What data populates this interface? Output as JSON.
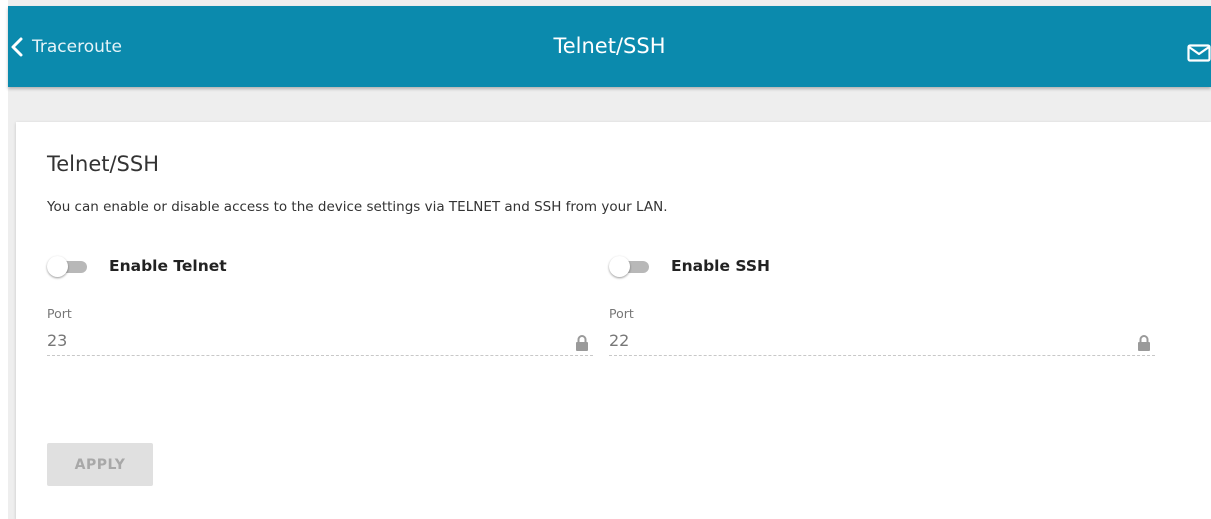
{
  "header": {
    "back_label": "Traceroute",
    "title": "Telnet/SSH",
    "icons": [
      "chevron-left-icon",
      "mail-icon"
    ]
  },
  "section": {
    "title": "Telnet/SSH",
    "description": "You can enable or disable access to the device settings via TELNET and SSH from your LAN."
  },
  "telnet": {
    "toggle_label": "Enable Telnet",
    "enabled": false,
    "port_label": "Port",
    "port_value": "23",
    "locked": true
  },
  "ssh": {
    "toggle_label": "Enable SSH",
    "enabled": false,
    "port_label": "Port",
    "port_value": "22",
    "locked": true
  },
  "actions": {
    "apply_label": "APPLY",
    "apply_enabled": false
  },
  "colors": {
    "header_bg": "#0b8aad",
    "toggle_off": "#b8b8b8",
    "button_disabled": "#e0e0e0"
  }
}
